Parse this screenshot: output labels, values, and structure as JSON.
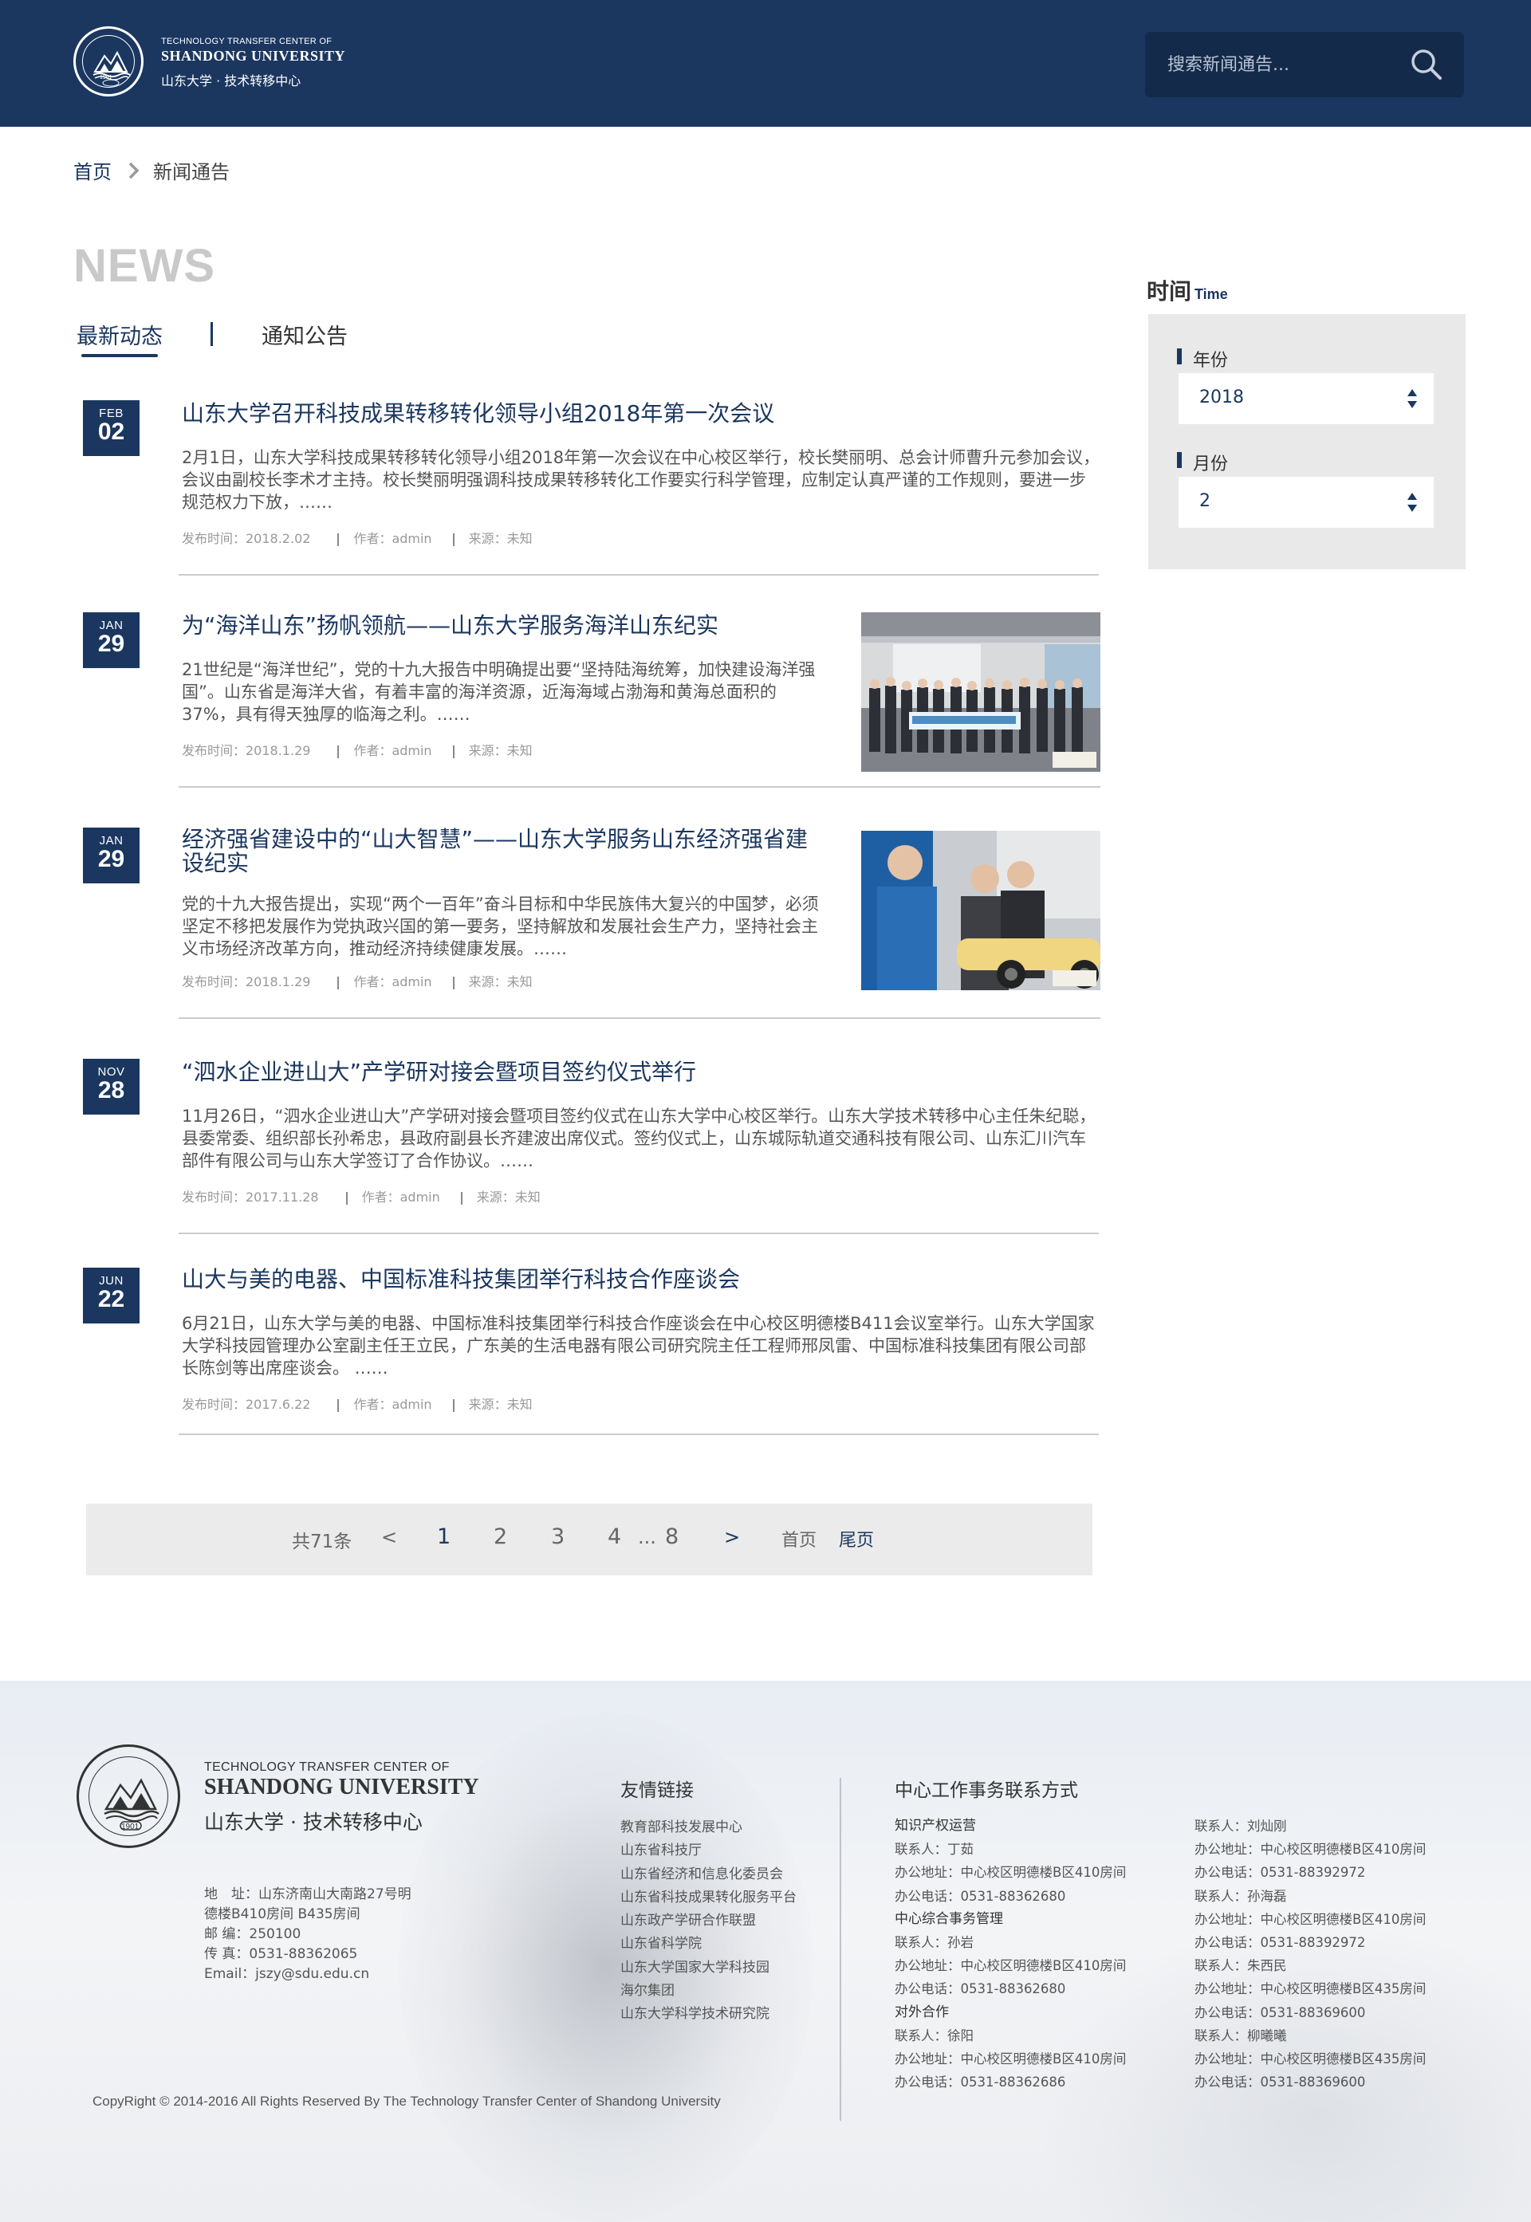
{
  "header": {
    "logo_en_small": "TECHNOLOGY TRANSFER CENTER OF",
    "logo_en_big": "SHANDONG UNIVERSITY",
    "logo_cn": "山东大学 · 技术转移中心",
    "logo_seal_year": "1901",
    "search_placeholder": "搜索新闻通告..."
  },
  "breadcrumb": {
    "home": "首页",
    "current": "新闻通告"
  },
  "page_title": "NEWS",
  "tabs": {
    "latest": "最新动态",
    "notice": "通知公告"
  },
  "articles": [
    {
      "month": "FEB",
      "day": "02",
      "title": "山东大学召开科技成果转移转化领导小组2018年第一次会议",
      "body": "2月1日，山东大学科技成果转移转化领导小组2018年第一次会议在中心校区举行，校长樊丽明、总会计师曹升元参加会议，会议由副校长李术才主持。校长樊丽明强调科技成果转移转化工作要实行科学管理，应制定认真严谨的工作规则，要进一步规范权力下放，……",
      "date": "发布时间：2018.2.02",
      "author": "作者：admin",
      "source": "来源：未知"
    },
    {
      "month": "JAN",
      "day": "29",
      "title": "为“海洋山东”扬帆领航——山东大学服务海洋山东纪实",
      "body": "21世纪是“海洋世纪”，党的十九大报告中明确提出要“坚持陆海统筹，加快建设海洋强国”。山东省是海洋大省，有着丰富的海洋资源，近海海域占渤海和黄海总面积的37%，具有得天独厚的临海之利。……",
      "date": "发布时间：2018.1.29",
      "author": "作者：admin",
      "source": "来源：未知"
    },
    {
      "month": "JAN",
      "day": "29",
      "title": "经济强省建设中的“山大智慧”——山东大学服务山东经济强省建设纪实",
      "body": "党的十九大报告提出，实现“两个一百年”奋斗目标和中华民族伟大复兴的中国梦，必须坚定不移把发展作为党执政兴国的第一要务，坚持解放和发展社会生产力，坚持社会主义市场经济改革方向，推动经济持续健康发展。……",
      "date": "发布时间：2018.1.29",
      "author": "作者：admin",
      "source": "来源：未知"
    },
    {
      "month": "NOV",
      "day": "28",
      "title": "“泗水企业进山大”产学研对接会暨项目签约仪式举行",
      "body": "11月26日，“泗水企业进山大”产学研对接会暨项目签约仪式在山东大学中心校区举行。山东大学技术转移中心主任朱纪聪，县委常委、组织部长孙希忠，县政府副县长齐建波出席仪式。签约仪式上，山东城际轨道交通科技有限公司、山东汇川汽车部件有限公司与山东大学签订了合作协议。……",
      "date": "发布时间：2017.11.28",
      "author": "作者：admin",
      "source": "来源：未知"
    },
    {
      "month": "JUN",
      "day": "22",
      "title": "山大与美的电器、中国标准科技集团举行科技合作座谈会",
      "body": "6月21日，山东大学与美的电器、中国标准科技集团举行科技合作座谈会在中心校区明德楼B411会议室举行。山东大学国家大学科技园管理办公室副主任王立民，广东美的生活电器有限公司研究院主任工程师邢凤雷、中国标准科技集团有限公司部长陈剑等出席座谈会。 ……",
      "date": "发布时间：2017.6.22",
      "author": "作者：admin",
      "source": "来源：未知"
    }
  ],
  "sidebar": {
    "title": "时间",
    "title_en": "Time",
    "year_label": "年份",
    "year_value": "2018",
    "month_label": "月份",
    "month_value": "2"
  },
  "pagination": {
    "total": "共71条",
    "prev": "<",
    "pages": [
      "1",
      "2",
      "3",
      "4"
    ],
    "ellipsis": "...",
    "last_page": "8",
    "next": ">",
    "first": "首页",
    "last": "尾页"
  },
  "footer": {
    "en_small": "TECHNOLOGY TRANSFER CENTER OF",
    "en_big": "SHANDONG UNIVERSITY",
    "cn": "山东大学 · 技术转移中心",
    "seal_year": "1901",
    "address1": "地　址：山东济南山大南路27号明",
    "address2": "德楼B410房间 B435房间",
    "zip": "邮 编：250100",
    "fax": "传 真：0531-88362065",
    "email": "Email：jszy@sdu.edu.cn",
    "copyright": "CopyRight © 2014-2016 All Rights Reserved By The Technology Transfer Center of Shandong University",
    "links_title": "友情链接",
    "links": [
      "教育部科技发展中心",
      "山东省科技厅",
      "山东省经济和信息化委员会",
      "山东省科技成果转化服务平台",
      "山东政产学研合作联盟",
      "山东省科学院",
      "山东大学国家大学科技园",
      "海尔集团",
      "山东大学科学技术研究院"
    ],
    "contact_title": "中心工作事务联系方式",
    "contacts_left": [
      {
        "h": "知识产权运营",
        "lines": [
          "联系人：丁茹",
          "办公地址：中心校区明德楼B区410房间",
          "办公电话：0531-88362680"
        ]
      },
      {
        "h": "中心综合事务管理",
        "lines": [
          "联系人：孙岩",
          "办公地址：中心校区明德楼B区410房间",
          "办公电话：0531-88362680"
        ]
      },
      {
        "h": "对外合作",
        "lines": [
          "联系人：徐阳",
          "办公地址：中心校区明德楼B区410房间",
          "办公电话：0531-88362686"
        ]
      }
    ],
    "contacts_right": [
      "联系人：刘灿刚",
      "办公地址：中心校区明德楼B区410房间",
      "办公电话：0531-88392972",
      "联系人：孙海磊",
      "办公地址：中心校区明德楼B区410房间",
      "办公电话：0531-88392972",
      "联系人：朱西民",
      "办公地址：中心校区明德楼B区435房间",
      "办公电话：0531-88369600",
      "联系人：柳曦曦",
      "办公地址：中心校区明德楼B区435房间",
      "办公电话：0531-88369600"
    ]
  },
  "colors": {
    "brand": "#1b3760",
    "search_bg": "#142a4b",
    "panel": "#e9e9e9"
  }
}
